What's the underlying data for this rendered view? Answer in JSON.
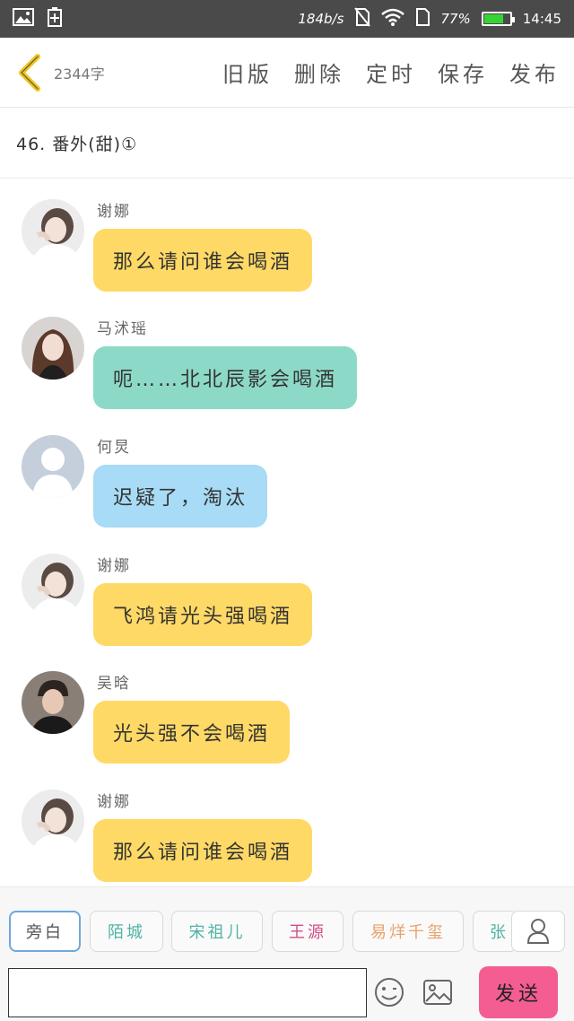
{
  "status_bar": {
    "net_speed": "184b/s",
    "battery": "77%",
    "battery_level": 0.77,
    "time": "14:45"
  },
  "header": {
    "word_count": "2344字",
    "actions": [
      "旧版",
      "删除",
      "定时",
      "保存",
      "发布"
    ]
  },
  "chapter": {
    "title": "46. 番外(甜)①"
  },
  "messages": [
    {
      "name": "谢娜",
      "text": "那么请问谁会喝酒",
      "bubble_color": "#ffd966",
      "avatar": "photo-woman-white"
    },
    {
      "name": "马沭瑶",
      "text": "呃……北北辰影会喝酒",
      "bubble_color": "#8dd9c8",
      "avatar": "photo-woman-dark"
    },
    {
      "name": "何炅",
      "text": "迟疑了，淘汰",
      "bubble_color": "#a8dbf5",
      "avatar": "default-person"
    },
    {
      "name": "谢娜",
      "text": "飞鸿请光头强喝酒",
      "bubble_color": "#ffd966",
      "avatar": "photo-woman-white"
    },
    {
      "name": "吴晗",
      "text": "光头强不会喝酒",
      "bubble_color": "#ffd966",
      "avatar": "photo-man"
    },
    {
      "name": "谢娜",
      "text": "那么请问谁会喝酒",
      "bubble_color": "#ffd966",
      "avatar": "photo-woman-white"
    }
  ],
  "characters": [
    {
      "label": "旁白",
      "color": "#555555",
      "selected": true
    },
    {
      "label": "陌城",
      "color": "#4fb3a6"
    },
    {
      "label": "宋祖儿",
      "color": "#4fb3a6"
    },
    {
      "label": "王源",
      "color": "#d0508a"
    },
    {
      "label": "易烊千玺",
      "color": "#e8a16a"
    },
    {
      "label": "张",
      "color": "#4fb3a6"
    }
  ],
  "input": {
    "placeholder": "",
    "send_label": "发送"
  },
  "colors": {
    "send_button": "#f45d91",
    "status_bar": "#4a4a4a",
    "back_arrow": "#f0c419"
  }
}
